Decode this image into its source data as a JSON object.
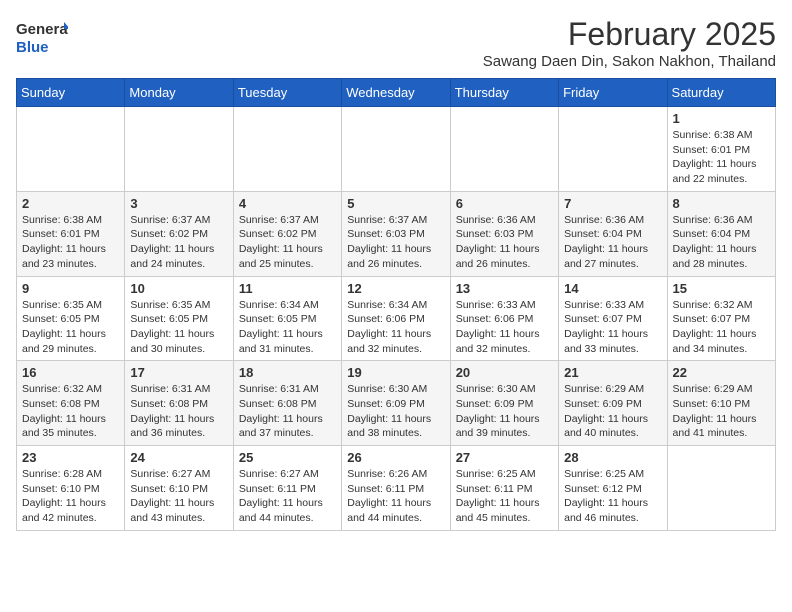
{
  "header": {
    "logo_general": "General",
    "logo_blue": "Blue",
    "month_title": "February 2025",
    "subtitle": "Sawang Daen Din, Sakon Nakhon, Thailand"
  },
  "weekdays": [
    "Sunday",
    "Monday",
    "Tuesday",
    "Wednesday",
    "Thursday",
    "Friday",
    "Saturday"
  ],
  "weeks": [
    [
      {
        "day": "",
        "info": ""
      },
      {
        "day": "",
        "info": ""
      },
      {
        "day": "",
        "info": ""
      },
      {
        "day": "",
        "info": ""
      },
      {
        "day": "",
        "info": ""
      },
      {
        "day": "",
        "info": ""
      },
      {
        "day": "1",
        "info": "Sunrise: 6:38 AM\nSunset: 6:01 PM\nDaylight: 11 hours and 22 minutes."
      }
    ],
    [
      {
        "day": "2",
        "info": "Sunrise: 6:38 AM\nSunset: 6:01 PM\nDaylight: 11 hours and 23 minutes."
      },
      {
        "day": "3",
        "info": "Sunrise: 6:37 AM\nSunset: 6:02 PM\nDaylight: 11 hours and 24 minutes."
      },
      {
        "day": "4",
        "info": "Sunrise: 6:37 AM\nSunset: 6:02 PM\nDaylight: 11 hours and 25 minutes."
      },
      {
        "day": "5",
        "info": "Sunrise: 6:37 AM\nSunset: 6:03 PM\nDaylight: 11 hours and 26 minutes."
      },
      {
        "day": "6",
        "info": "Sunrise: 6:36 AM\nSunset: 6:03 PM\nDaylight: 11 hours and 26 minutes."
      },
      {
        "day": "7",
        "info": "Sunrise: 6:36 AM\nSunset: 6:04 PM\nDaylight: 11 hours and 27 minutes."
      },
      {
        "day": "8",
        "info": "Sunrise: 6:36 AM\nSunset: 6:04 PM\nDaylight: 11 hours and 28 minutes."
      }
    ],
    [
      {
        "day": "9",
        "info": "Sunrise: 6:35 AM\nSunset: 6:05 PM\nDaylight: 11 hours and 29 minutes."
      },
      {
        "day": "10",
        "info": "Sunrise: 6:35 AM\nSunset: 6:05 PM\nDaylight: 11 hours and 30 minutes."
      },
      {
        "day": "11",
        "info": "Sunrise: 6:34 AM\nSunset: 6:05 PM\nDaylight: 11 hours and 31 minutes."
      },
      {
        "day": "12",
        "info": "Sunrise: 6:34 AM\nSunset: 6:06 PM\nDaylight: 11 hours and 32 minutes."
      },
      {
        "day": "13",
        "info": "Sunrise: 6:33 AM\nSunset: 6:06 PM\nDaylight: 11 hours and 32 minutes."
      },
      {
        "day": "14",
        "info": "Sunrise: 6:33 AM\nSunset: 6:07 PM\nDaylight: 11 hours and 33 minutes."
      },
      {
        "day": "15",
        "info": "Sunrise: 6:32 AM\nSunset: 6:07 PM\nDaylight: 11 hours and 34 minutes."
      }
    ],
    [
      {
        "day": "16",
        "info": "Sunrise: 6:32 AM\nSunset: 6:08 PM\nDaylight: 11 hours and 35 minutes."
      },
      {
        "day": "17",
        "info": "Sunrise: 6:31 AM\nSunset: 6:08 PM\nDaylight: 11 hours and 36 minutes."
      },
      {
        "day": "18",
        "info": "Sunrise: 6:31 AM\nSunset: 6:08 PM\nDaylight: 11 hours and 37 minutes."
      },
      {
        "day": "19",
        "info": "Sunrise: 6:30 AM\nSunset: 6:09 PM\nDaylight: 11 hours and 38 minutes."
      },
      {
        "day": "20",
        "info": "Sunrise: 6:30 AM\nSunset: 6:09 PM\nDaylight: 11 hours and 39 minutes."
      },
      {
        "day": "21",
        "info": "Sunrise: 6:29 AM\nSunset: 6:09 PM\nDaylight: 11 hours and 40 minutes."
      },
      {
        "day": "22",
        "info": "Sunrise: 6:29 AM\nSunset: 6:10 PM\nDaylight: 11 hours and 41 minutes."
      }
    ],
    [
      {
        "day": "23",
        "info": "Sunrise: 6:28 AM\nSunset: 6:10 PM\nDaylight: 11 hours and 42 minutes."
      },
      {
        "day": "24",
        "info": "Sunrise: 6:27 AM\nSunset: 6:10 PM\nDaylight: 11 hours and 43 minutes."
      },
      {
        "day": "25",
        "info": "Sunrise: 6:27 AM\nSunset: 6:11 PM\nDaylight: 11 hours and 44 minutes."
      },
      {
        "day": "26",
        "info": "Sunrise: 6:26 AM\nSunset: 6:11 PM\nDaylight: 11 hours and 44 minutes."
      },
      {
        "day": "27",
        "info": "Sunrise: 6:25 AM\nSunset: 6:11 PM\nDaylight: 11 hours and 45 minutes."
      },
      {
        "day": "28",
        "info": "Sunrise: 6:25 AM\nSunset: 6:12 PM\nDaylight: 11 hours and 46 minutes."
      },
      {
        "day": "",
        "info": ""
      }
    ]
  ]
}
